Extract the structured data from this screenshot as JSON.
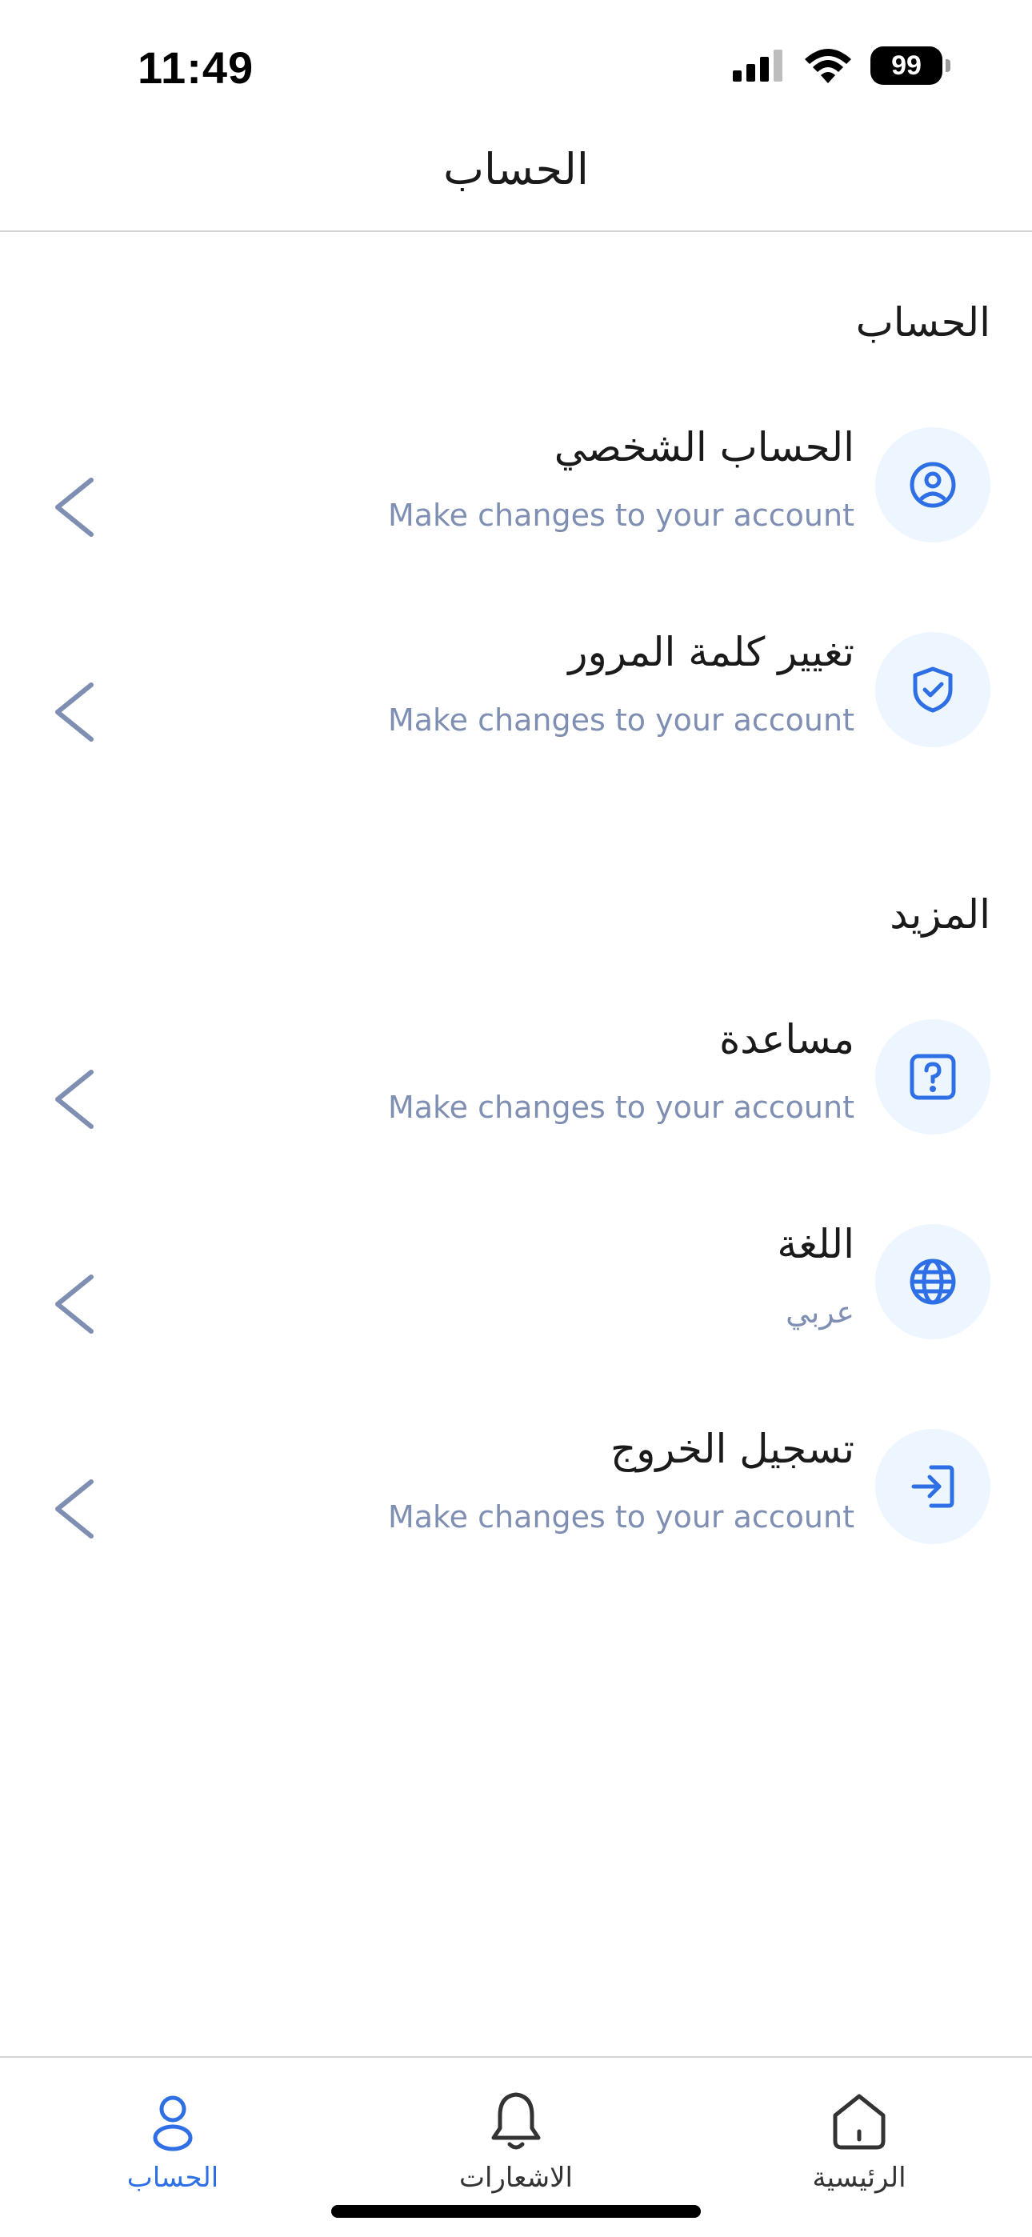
{
  "status_bar": {
    "time": "11:49",
    "battery": "99"
  },
  "header": {
    "title": "الحساب"
  },
  "sections": [
    {
      "heading": "الحساب",
      "items": [
        {
          "icon": "user-circle-icon",
          "title": "الحساب الشخصي",
          "subtitle": "Make changes to your account"
        },
        {
          "icon": "shield-check-icon",
          "title": "تغيير كلمة المرور",
          "subtitle": "Make changes to your account"
        }
      ]
    },
    {
      "heading": "المزيد",
      "items": [
        {
          "icon": "help-square-icon",
          "title": "مساعدة",
          "subtitle": "Make changes to your account"
        },
        {
          "icon": "globe-icon",
          "title": "اللغة",
          "subtitle": "عربي"
        },
        {
          "icon": "logout-icon",
          "title": "تسجيل الخروج",
          "subtitle": "Make changes to your account"
        }
      ]
    }
  ],
  "tabbar": {
    "tabs": [
      {
        "label": "الحساب",
        "icon": "user-icon",
        "active": true
      },
      {
        "label": "الاشعارات",
        "icon": "bell-icon",
        "active": false
      },
      {
        "label": "الرئيسية",
        "icon": "home-icon",
        "active": false
      }
    ]
  },
  "colors": {
    "accent": "#2f6fe6",
    "icon_bg": "#edf5ff",
    "subtitle": "#7f8fb3",
    "chevron": "#7f8fb3"
  }
}
